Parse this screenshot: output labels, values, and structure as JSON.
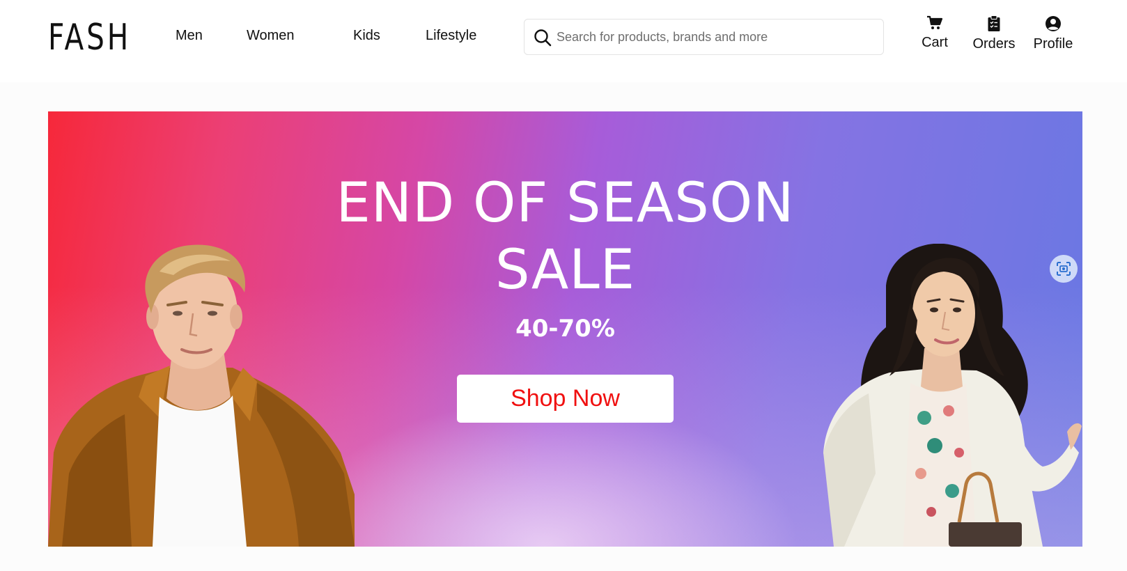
{
  "brand": {
    "logo_text": "FASH"
  },
  "nav": {
    "items": [
      {
        "label": "Men"
      },
      {
        "label": "Women"
      },
      {
        "label": "Kids"
      },
      {
        "label": "Lifestyle"
      }
    ]
  },
  "search": {
    "placeholder": "Search for products, brands and more",
    "value": "",
    "icon": "search-icon"
  },
  "actions": {
    "cart": {
      "label": "Cart",
      "icon": "cart-icon"
    },
    "orders": {
      "label": "Orders",
      "icon": "clipboard-icon"
    },
    "profile": {
      "label": "Profile",
      "icon": "user-circle-icon"
    }
  },
  "hero": {
    "title_line1": "END OF SEASON",
    "title_line2": "SALE",
    "discount": "40-70%",
    "cta_label": "Shop Now",
    "cta_color": "#f01010",
    "gradient_colors": [
      "#f6283a",
      "#d547a6",
      "#a75cd9",
      "#6878e3"
    ],
    "lens_icon": "visual-search-icon"
  }
}
